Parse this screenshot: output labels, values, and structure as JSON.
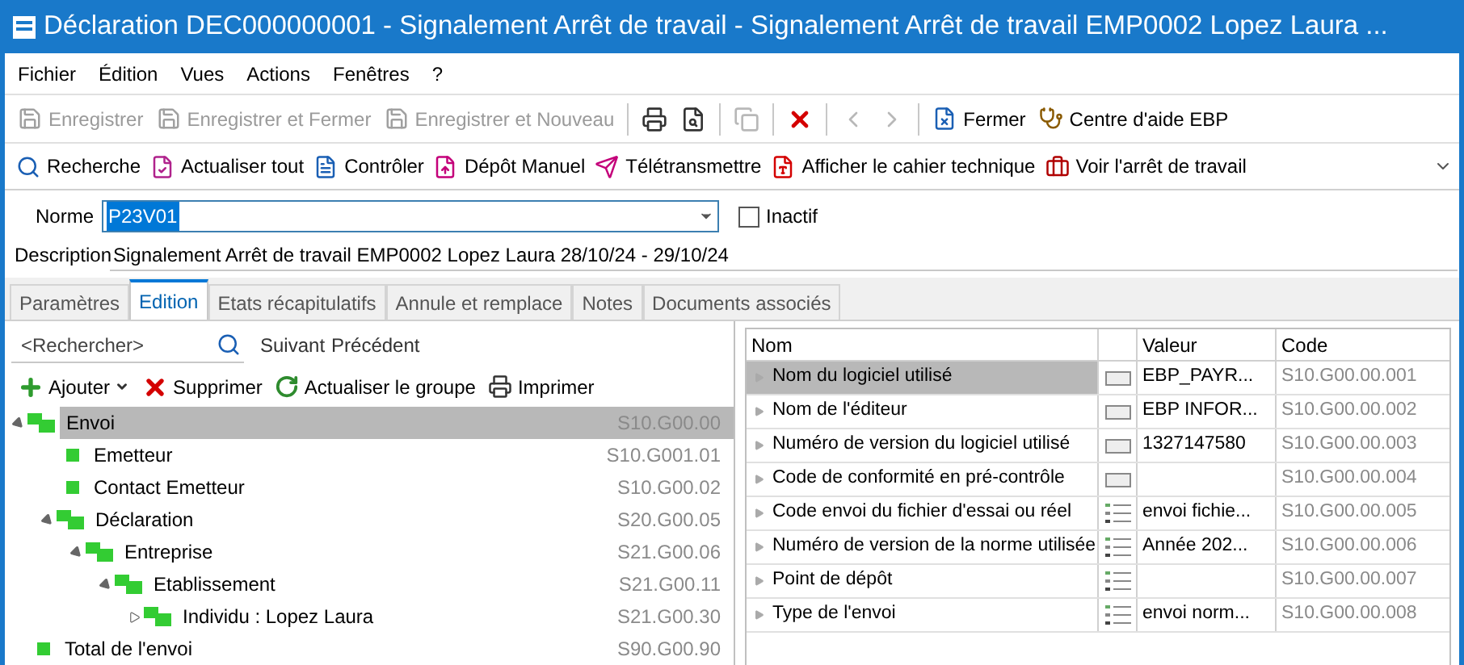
{
  "window": {
    "title": "Déclaration DEC000000001  - Signalement Arrêt de travail - Signalement Arrêt de travail EMP0002 Lopez Laura ..."
  },
  "menu": [
    "Fichier",
    "Édition",
    "Vues",
    "Actions",
    "Fenêtres",
    "?"
  ],
  "toolbar": {
    "labeled": [
      {
        "label": "Enregistrer",
        "disabled": true
      },
      {
        "label": "Enregistrer et Fermer",
        "disabled": true
      },
      {
        "label": "Enregistrer et Nouveau",
        "disabled": true
      }
    ],
    "icon_buttons": [
      {
        "disabled": false
      },
      {
        "disabled": false
      },
      {
        "disabled": true
      },
      {
        "disabled": false
      },
      {
        "disabled": true
      },
      {
        "disabled": true
      }
    ],
    "right": [
      {
        "label": "Fermer",
        "disabled": false
      },
      {
        "label": "Centre d'aide EBP",
        "disabled": false
      }
    ]
  },
  "actions": [
    "Recherche",
    "Actualiser tout",
    "Contrôler",
    "Dépôt Manuel",
    "Télétransmettre",
    "Afficher le cahier technique",
    "Voir l'arrêt de travail"
  ],
  "form": {
    "norme_label": "Norme",
    "norme_value": "P23V01",
    "inactif_label": "Inactif",
    "inactif_checked": false,
    "description_label": "Description",
    "description_value": "Signalement Arrêt de travail EMP0002 Lopez Laura 28/10/24 - 29/10/24"
  },
  "tabs": [
    {
      "label": "Paramètres",
      "selected": false
    },
    {
      "label": "Edition",
      "selected": true
    },
    {
      "label": "Etats récapitulatifs",
      "selected": false
    },
    {
      "label": "Annule et remplace",
      "selected": false
    },
    {
      "label": "Notes",
      "selected": false
    },
    {
      "label": "Documents associés",
      "selected": false
    }
  ],
  "search": {
    "placeholder": "<Rechercher>",
    "next": "Suivant",
    "previous": "Précédent"
  },
  "tree_toolbar": [
    "Ajouter",
    "Supprimer",
    "Actualiser le groupe",
    "Imprimer"
  ],
  "tree": [
    {
      "label": "Envoi",
      "code": "S10.G00.00",
      "selected": true,
      "expanded": true,
      "children": [
        {
          "label": "Emetteur",
          "code": "S10.G001.01",
          "selected": false
        },
        {
          "label": "Contact Emetteur",
          "code": "S10.G00.02",
          "selected": false
        },
        {
          "label": "Déclaration",
          "code": "S20.G00.05",
          "selected": false,
          "expanded": true,
          "children": [
            {
              "label": "Entreprise",
              "code": "S21.G00.06",
              "selected": false,
              "expanded": true,
              "children": [
                {
                  "label": "Etablissement",
                  "code": "S21.G00.11",
                  "selected": false,
                  "expanded": true,
                  "children": [
                    {
                      "label": "Individu : Lopez Laura",
                      "code": "S21.G00.30",
                      "selected": false,
                      "expanded": false
                    }
                  ]
                }
              ]
            }
          ]
        }
      ]
    },
    {
      "label": "Total de l'envoi",
      "code": "S90.G00.90",
      "selected": false
    }
  ],
  "table": {
    "columns": [
      "Nom",
      "Valeur",
      "Code"
    ],
    "rows": [
      {
        "name": "Nom du logiciel utilisé",
        "kind": "text",
        "value": "EBP_PAYR...",
        "code": "S10.G00.00.001",
        "selected": true
      },
      {
        "name": "Nom de l'éditeur",
        "kind": "text",
        "value": "EBP INFOR...",
        "code": "S10.G00.00.002",
        "selected": false
      },
      {
        "name": "Numéro de version du logiciel utilisé",
        "kind": "text",
        "value": "1327147580",
        "code": "S10.G00.00.003",
        "selected": false
      },
      {
        "name": "Code de conformité en pré-contrôle",
        "kind": "text",
        "code": "S10.G00.00.004",
        "selected": false
      },
      {
        "name": "Code envoi du fichier d'essai ou réel",
        "kind": "list",
        "value": "envoi fichie...",
        "code": "S10.G00.00.005",
        "selected": false
      },
      {
        "name": "Numéro de version de la norme utilisée",
        "kind": "list",
        "value": "Année 202...",
        "code": "S10.G00.00.006",
        "selected": false
      },
      {
        "name": "Point de dépôt",
        "kind": "list",
        "code": "S10.G00.00.007",
        "selected": false
      },
      {
        "name": "Type de l'envoi",
        "kind": "list",
        "value": "envoi norm...",
        "code": "S10.G00.00.008",
        "selected": false
      }
    ]
  }
}
